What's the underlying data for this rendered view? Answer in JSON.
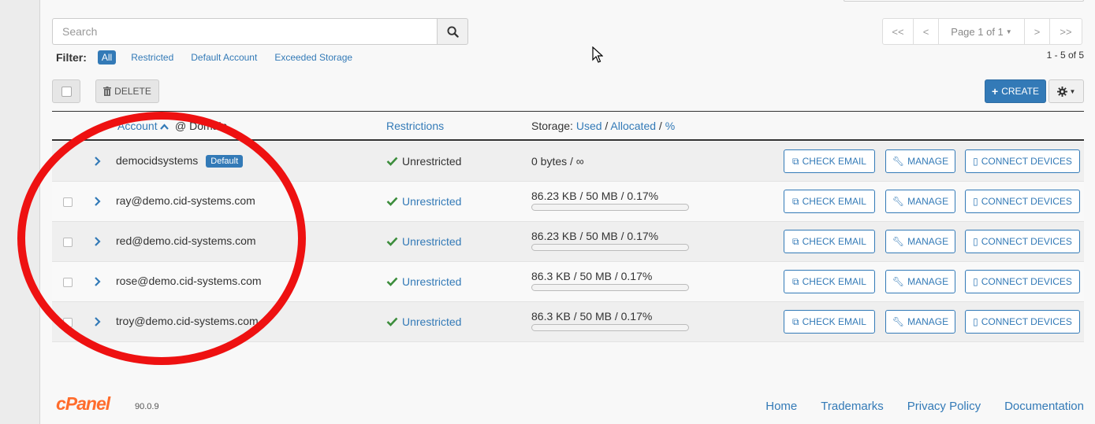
{
  "search": {
    "placeholder": "Search"
  },
  "filter": {
    "label": "Filter:",
    "options": [
      "All",
      "Restricted",
      "Default Account",
      "Exceeded Storage"
    ]
  },
  "pager": {
    "first": "<<",
    "prev": "<",
    "page": "Page 1 of 1",
    "next": ">",
    "last": ">>",
    "count": "1 - 5 of 5"
  },
  "actions": {
    "delete": "DELETE",
    "create": "CREATE"
  },
  "table": {
    "headers": {
      "account": "Account",
      "at_domain": "@ Domain",
      "restrictions": "Restrictions",
      "storage_label": "Storage:",
      "used": "Used",
      "allocated": "Allocated",
      "pct": "%"
    },
    "rows": [
      {
        "account": "democidsystems",
        "badge": "Default",
        "restriction": "Unrestricted",
        "storage": "0 bytes / ∞",
        "used_fraction": null
      },
      {
        "account": "ray@demo.cid-systems.com",
        "restriction": "Unrestricted",
        "storage": "86.23 KB / 50 MB / 0.17%",
        "used_fraction": 0.0017
      },
      {
        "account": "red@demo.cid-systems.com",
        "restriction": "Unrestricted",
        "storage": "86.23 KB / 50 MB / 0.17%",
        "used_fraction": 0.0017
      },
      {
        "account": "rose@demo.cid-systems.com",
        "restriction": "Unrestricted",
        "storage": "86.3 KB / 50 MB / 0.17%",
        "used_fraction": 0.0017
      },
      {
        "account": "troy@demo.cid-systems.com",
        "restriction": "Unrestricted",
        "storage": "86.3 KB / 50 MB / 0.17%",
        "used_fraction": 0.0017
      }
    ],
    "row_buttons": {
      "check_email": "CHECK EMAIL",
      "manage": "MANAGE",
      "connect": "CONNECT DEVICES"
    }
  },
  "footer": {
    "logo": "cPanel",
    "version": "90.0.9",
    "links": [
      "Home",
      "Trademarks",
      "Privacy Policy",
      "Documentation"
    ]
  },
  "colors": {
    "accent": "#337ab7",
    "check": "#3c8d3c",
    "annotation": "#ee1111",
    "brand": "#ff6c2c"
  }
}
